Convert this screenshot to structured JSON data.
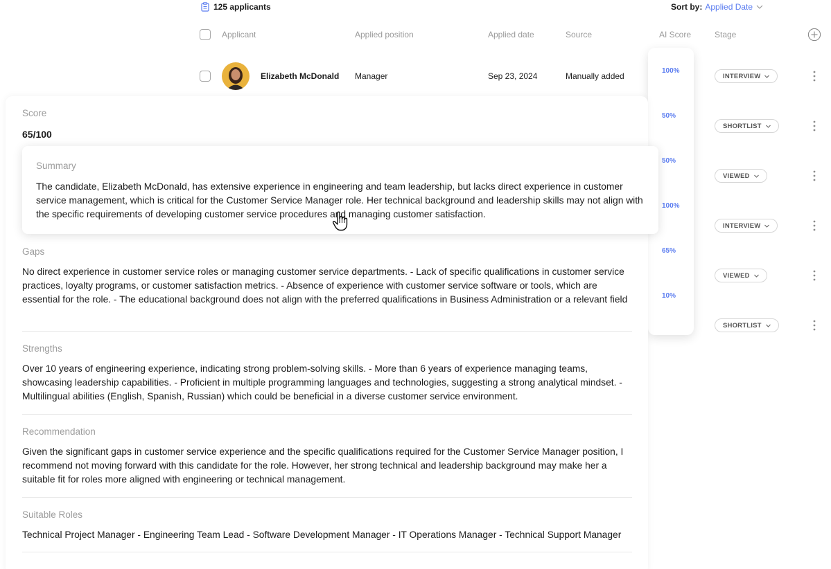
{
  "header": {
    "applicant_count": "125 applicants",
    "sort_label": "Sort by:",
    "sort_value": "Applied Date"
  },
  "columns": {
    "applicant": "Applicant",
    "applied_position": "Applied position",
    "applied_date": "Applied date",
    "source": "Source",
    "ai_score": "AI Score",
    "stage": "Stage"
  },
  "row": {
    "name": "Elizabeth McDonald",
    "position": "Manager",
    "date": "Sep 23, 2024",
    "source": "Manually added"
  },
  "ai_scores": [
    "100%",
    "50%",
    "50%",
    "100%",
    "65%",
    "10%"
  ],
  "stages": [
    "INTERVIEW",
    "SHORTLIST",
    "VIEWED",
    "INTERVIEW",
    "VIEWED",
    "SHORTLIST"
  ],
  "details": {
    "score_label": "Score",
    "score_value": "65/100",
    "summary_label": "Summary",
    "summary_text": "The candidate, Elizabeth McDonald, has extensive experience in engineering and team leadership, but lacks direct experience in customer service management, which is critical for the Customer Service Manager role. Her technical background and leadership skills may not align with the specific requirements of developing customer service procedures and managing customer satisfaction.",
    "gaps_label": "Gaps",
    "gaps_text": "No direct experience in customer service roles or managing customer service departments. - Lack of specific qualifications in customer service practices, loyalty programs, or customer satisfaction metrics. - Absence of experience with customer service software or tools, which are essential for the role. - The educational background does not align with the preferred qualifications in Business Administration or a relevant field",
    "strengths_label": "Strengths",
    "strengths_text": "Over 10 years of engineering experience, indicating strong problem-solving skills. - More than 6 years of experience managing teams, showcasing leadership capabilities. - Proficient in multiple programming languages and technologies, suggesting a strong analytical mindset. - Multilingual abilities (English, Spanish, Russian) which could be beneficial in a diverse customer service environment.",
    "recommendation_label": "Recommendation",
    "recommendation_text": "Given the significant gaps in customer service experience and the specific qualifications required for the Customer Service Manager position, I recommend not moving forward with this candidate for the role. However, her strong technical and leadership background may make her a suitable fit for roles more aligned with engineering or technical management.",
    "roles_label": "Suitable Roles",
    "roles_text": "Technical Project Manager - Engineering Team Lead - Software Development Manager - IT Operations Manager - Technical Support Manager"
  },
  "colors": {
    "accent": "#5a7cf0",
    "muted_text": "#9c9c9c",
    "body_text": "#1c1c1c"
  },
  "icons": {
    "applicant_count": "clipboard-icon",
    "sort": "chevron-down-icon",
    "add_column": "plus-circle-icon",
    "row_menu": "kebab-icon",
    "cursor": "hand-pointer-icon"
  }
}
